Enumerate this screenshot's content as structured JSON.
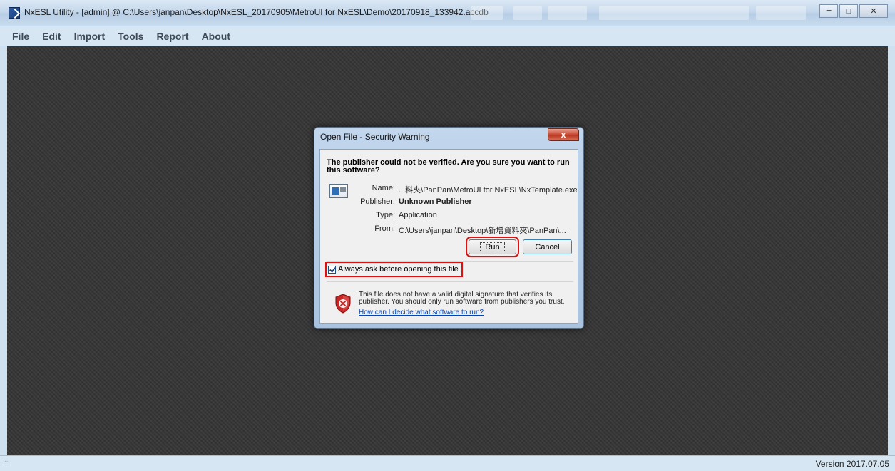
{
  "window": {
    "title": "NxESL Utility - [admin] @ C:\\Users\\janpan\\Desktop\\NxESL_20170905\\MetroUI for NxESL\\Demo\\20170918_133942.accdb"
  },
  "menu": {
    "items": [
      {
        "label": "File"
      },
      {
        "label": "Edit"
      },
      {
        "label": "Import"
      },
      {
        "label": "Tools"
      },
      {
        "label": "Report"
      },
      {
        "label": "About"
      }
    ]
  },
  "statusbar": {
    "grip": "::",
    "version": "Version 2017.07.05"
  },
  "dialog": {
    "title": "Open File - Security Warning",
    "close_glyph": "x",
    "question": "The publisher could not be verified.  Are you sure you want to run this software?",
    "name_label": "Name:",
    "name_value": "...料夾\\PanPan\\MetroUI for NxESL\\NxTemplate.exe",
    "publisher_label": "Publisher:",
    "publisher_value": "Unknown Publisher",
    "type_label": "Type:",
    "type_value": "Application",
    "from_label": "From:",
    "from_value": "C:\\Users\\janpan\\Desktop\\新增資料夾\\PanPan\\...",
    "run_label": "Run",
    "cancel_label": "Cancel",
    "checkbox_label": "Always ask before opening this file",
    "checkbox_checked": true,
    "warning_text": "This file does not have a valid digital signature that verifies its publisher.  You should only run software from publishers you trust.",
    "help_link": "How can I decide what software to run?"
  },
  "colors": {
    "highlight": "#e01010",
    "link": "#0645ad",
    "desktop_bg": "#353535"
  }
}
